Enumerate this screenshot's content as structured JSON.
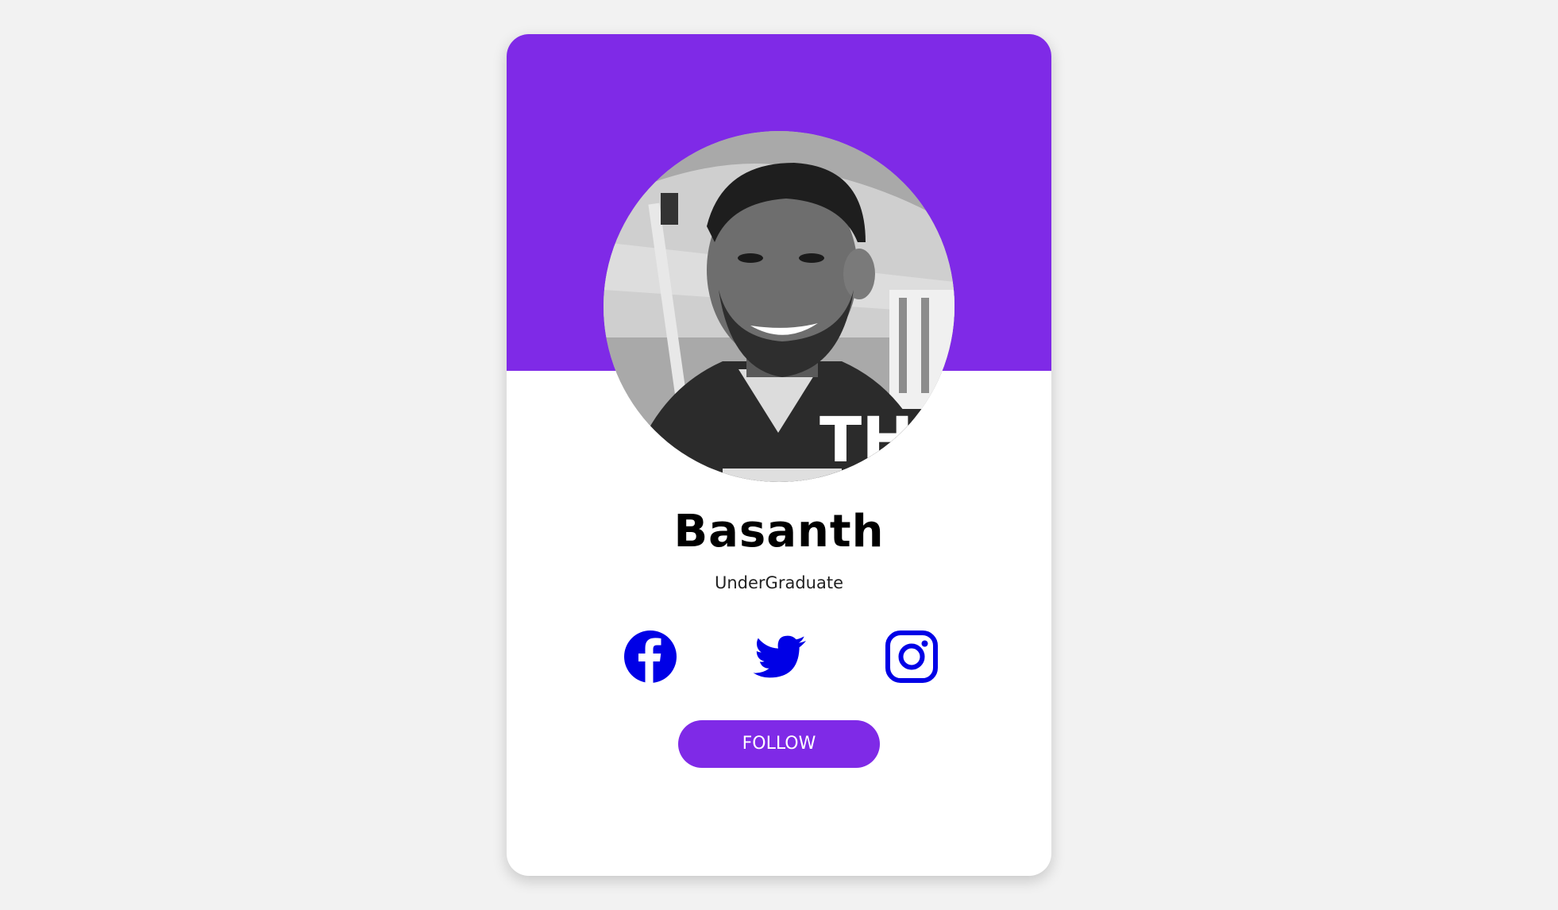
{
  "profile": {
    "name": "Basanth",
    "role": "UnderGraduate",
    "photo_overlay_text": "THE"
  },
  "actions": {
    "follow_label": "FOLLOW"
  },
  "social_links": [
    {
      "icon": "facebook-icon"
    },
    {
      "icon": "twitter-icon"
    },
    {
      "icon": "instagram-icon"
    }
  ],
  "colors": {
    "accent": "#7f2ae7",
    "icon_blue": "#0000e6",
    "background": "#f2f2f2",
    "card": "#ffffff"
  }
}
